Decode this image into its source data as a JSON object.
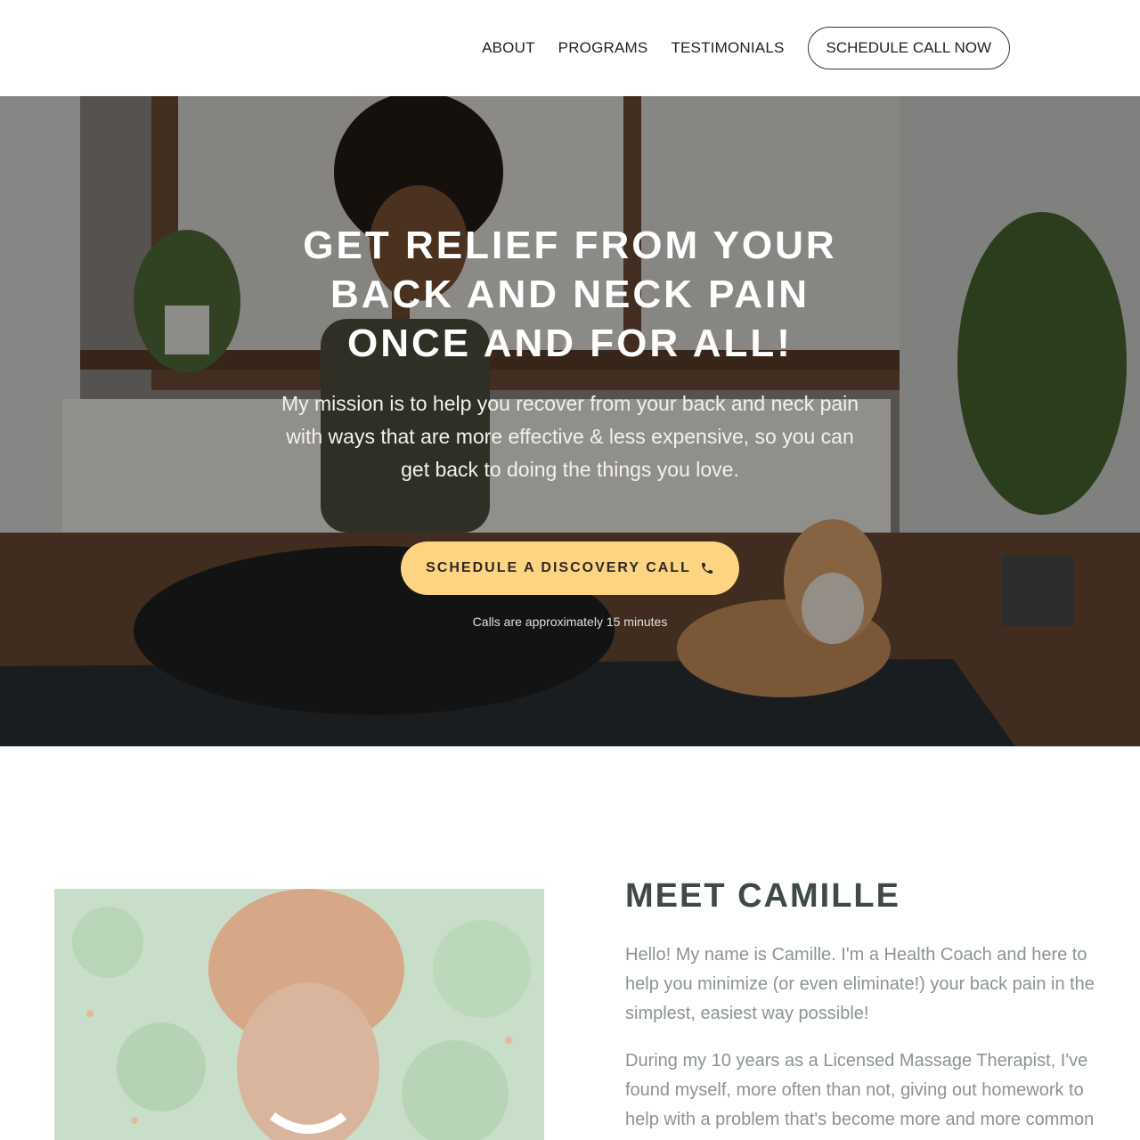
{
  "header": {
    "nav": [
      "ABOUT",
      "PROGRAMS",
      "TESTIMONIALS"
    ],
    "cta_label": "SCHEDULE CALL NOW"
  },
  "hero": {
    "title": "GET RELIEF FROM YOUR BACK AND NECK PAIN ONCE AND FOR ALL!",
    "subtitle": "My mission is to help you recover from your back and neck pain with ways that are more effective & less expensive, so you can get back to doing the things you love.",
    "button_label": "SCHEDULE A DISCOVERY CALL",
    "button_icon": "phone-icon",
    "note": "Calls are approximately 15 minutes",
    "image": "woman-meditating-with-dog-photo"
  },
  "about": {
    "title": "MEET CAMILLE",
    "paragraphs": [
      "Hello! My name is Camille. I'm a Health Coach and here to help you minimize (or even eliminate!) your back pain in the simplest, easiest way possible!",
      "During my 10 years as a Licensed Massage Therapist, I've found myself, more often than not, giving out homework to help with a problem that's become more and more common"
    ],
    "image": "camille-portrait-photo"
  },
  "colors": {
    "accent_button": "#fdd481",
    "heading_dark": "#3f4a45",
    "body_muted": "#8b9590"
  }
}
